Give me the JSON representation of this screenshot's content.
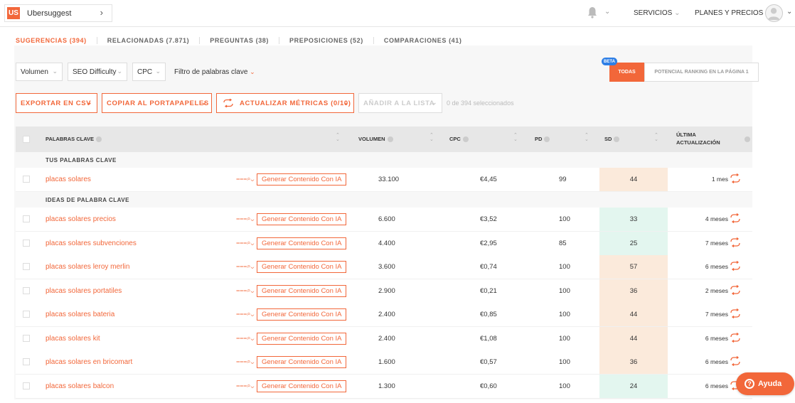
{
  "header": {
    "project_badge": "US",
    "project_name": "Ubersuggest",
    "nav_services": "SERVICIOS",
    "nav_plans": "PLANES Y PRECIOS"
  },
  "tabs": [
    {
      "label": "SUGERENCIAS (394)",
      "active": true
    },
    {
      "label": "RELACIONADAS (7.871)",
      "active": false
    },
    {
      "label": "PREGUNTAS (38)",
      "active": false
    },
    {
      "label": "PREPOSICIONES (52)",
      "active": false
    },
    {
      "label": "COMPARACIONES (41)",
      "active": false
    }
  ],
  "filters": {
    "volumen": "Volumen",
    "seo_difficulty": "SEO Difficulty",
    "cpc": "CPC",
    "keyword_filter": "Filtro de palabras clave"
  },
  "segment": {
    "beta": "BETA",
    "todas": "TODAS",
    "potencial": "POTENCIAL RANKING EN LA PÁGINA 1"
  },
  "actions": {
    "export": "EXPORTAR EN CSV",
    "copy": "COPIAR AL PORTAPAPELES",
    "update": "ACTUALIZAR MÉTRICAS (0/10)",
    "add_list": "AÑADIR A LA LISTA",
    "selected": "0 de 394 seleccionados"
  },
  "table": {
    "columns": {
      "keywords": "PALABRAS CLAVE",
      "volume": "VOLUMEN",
      "cpc": "CPC",
      "pd": "PD",
      "sd": "SD",
      "last_update_1": "ÚLTIMA",
      "last_update_2": "ACTUALIZACIÓN"
    },
    "group_yours": "TUS PALABRAS CLAVE",
    "group_ideas": "IDEAS DE PALABRA CLAVE",
    "generate_label": "Generar Contenido Con IA",
    "your_rows": [
      {
        "keyword": "placas solares",
        "volume": "33.100",
        "cpc": "€4,45",
        "pd": "99",
        "sd": "44",
        "sd_color": "#fbeadb",
        "updated": "1 mes"
      }
    ],
    "rows": [
      {
        "keyword": "placas solares precios",
        "volume": "6.600",
        "cpc": "€3,52",
        "pd": "100",
        "sd": "33",
        "sd_color": "#e3f6ef",
        "updated": "4 meses"
      },
      {
        "keyword": "placas solares subvenciones",
        "volume": "4.400",
        "cpc": "€2,95",
        "pd": "85",
        "sd": "25",
        "sd_color": "#e3f6ef",
        "updated": "7 meses"
      },
      {
        "keyword": "placas solares leroy merlin",
        "volume": "3.600",
        "cpc": "€0,74",
        "pd": "100",
        "sd": "57",
        "sd_color": "#fbeadb",
        "updated": "6 meses"
      },
      {
        "keyword": "placas solares portatiles",
        "volume": "2.900",
        "cpc": "€0,21",
        "pd": "100",
        "sd": "36",
        "sd_color": "#fbeadb",
        "updated": "2 meses"
      },
      {
        "keyword": "placas solares bateria",
        "volume": "2.400",
        "cpc": "€0,85",
        "pd": "100",
        "sd": "44",
        "sd_color": "#fbeadb",
        "updated": "7 meses"
      },
      {
        "keyword": "placas solares kit",
        "volume": "2.400",
        "cpc": "€1,08",
        "pd": "100",
        "sd": "44",
        "sd_color": "#fbeadb",
        "updated": "6 meses"
      },
      {
        "keyword": "placas solares en bricomart",
        "volume": "1.600",
        "cpc": "€0,57",
        "pd": "100",
        "sd": "36",
        "sd_color": "#fbeadb",
        "updated": "6 meses"
      },
      {
        "keyword": "placas solares balcon",
        "volume": "1.300",
        "cpc": "€0,60",
        "pd": "100",
        "sd": "24",
        "sd_color": "#e3f6ef",
        "updated": "6 meses"
      }
    ]
  },
  "help": {
    "label": "Ayuda"
  },
  "colors": {
    "accent": "#f2673a",
    "beta": "#2f7fe6"
  }
}
